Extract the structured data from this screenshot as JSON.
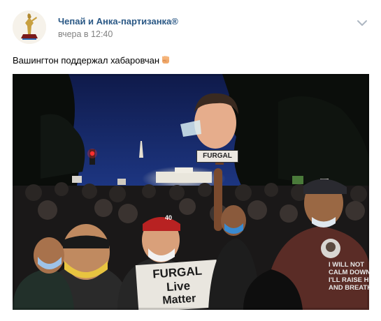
{
  "post": {
    "author": "Чепай и Анка-партизанка®",
    "time": "вчера в 12:40",
    "text": "Вашингтон поддержал хабаровчан",
    "emoji": "raised-fist-emoji"
  },
  "photo": {
    "head_sign": "FURGAL",
    "placard_line1": "FURGAL",
    "placard_line2": "Live",
    "placard_line3": "Matter",
    "shirt_lines": [
      "I WILL NOT",
      "CALM DOWN.",
      "I'LL RAISE HELL",
      "AND BREATHE"
    ],
    "cap_text": "40"
  },
  "icons": {
    "menu": "chevron-down-icon"
  },
  "colors": {
    "author_link": "#2a5885",
    "time_gray": "#828282",
    "night_sky": "#1a2a6a"
  }
}
